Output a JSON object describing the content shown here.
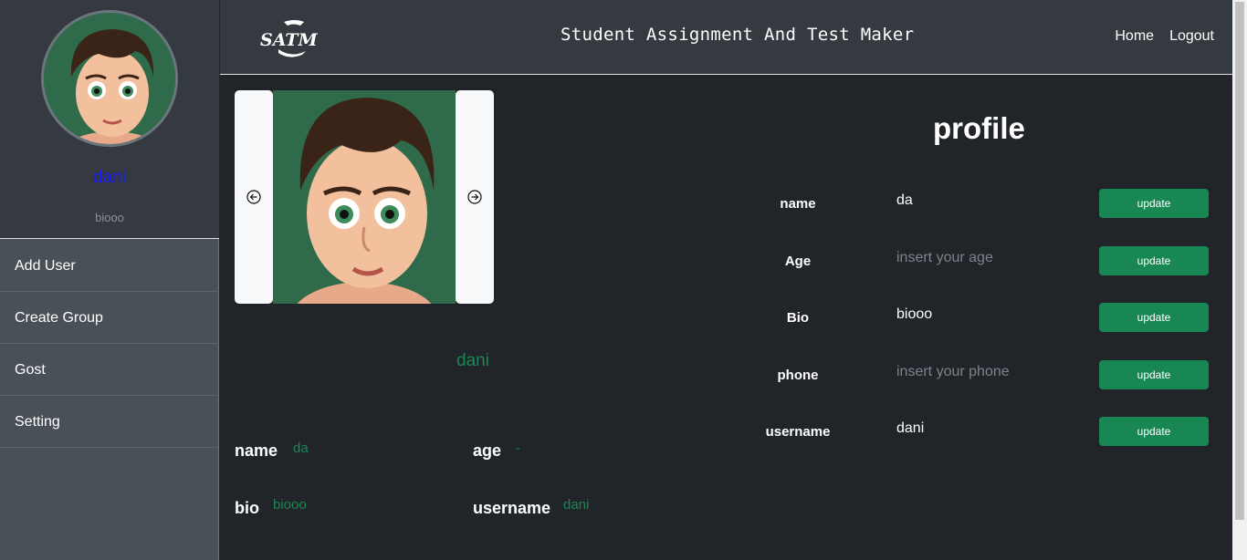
{
  "header": {
    "logo_text": "SATM",
    "title": "Student Assignment And Test Maker",
    "nav": [
      {
        "label": "Home"
      },
      {
        "label": "Logout"
      }
    ]
  },
  "sidebar": {
    "user_name": "dani",
    "user_bio": "biooo",
    "items": [
      {
        "label": "Add User"
      },
      {
        "label": "Create Group"
      },
      {
        "label": "Gost"
      },
      {
        "label": "Setting"
      }
    ]
  },
  "carousel": {
    "prev_icon": "arrow-left-circle-icon",
    "next_icon": "arrow-right-circle-icon"
  },
  "profile_card": {
    "display_name": "dani",
    "name_label": "name",
    "name_value": "da",
    "age_label": "age",
    "age_value": "-",
    "bio_label": "bio",
    "bio_value": "biooo",
    "username_label": "username",
    "username_value": "dani"
  },
  "profile_form": {
    "title": "profile",
    "update_label": "update",
    "fields": [
      {
        "label": "name",
        "value": "da",
        "placeholder": ""
      },
      {
        "label": "Age",
        "value": "",
        "placeholder": "insert your age"
      },
      {
        "label": "Bio",
        "value": "biooo",
        "placeholder": ""
      },
      {
        "label": "phone",
        "value": "",
        "placeholder": "insert your phone"
      },
      {
        "label": "username",
        "value": "dani",
        "placeholder": ""
      }
    ]
  },
  "colors": {
    "accent_green": "#198754",
    "user_name_blue": "#1a1aff",
    "dark_bg": "#212529",
    "header_bg": "#343a40",
    "sidebar_bg": "#495057"
  }
}
